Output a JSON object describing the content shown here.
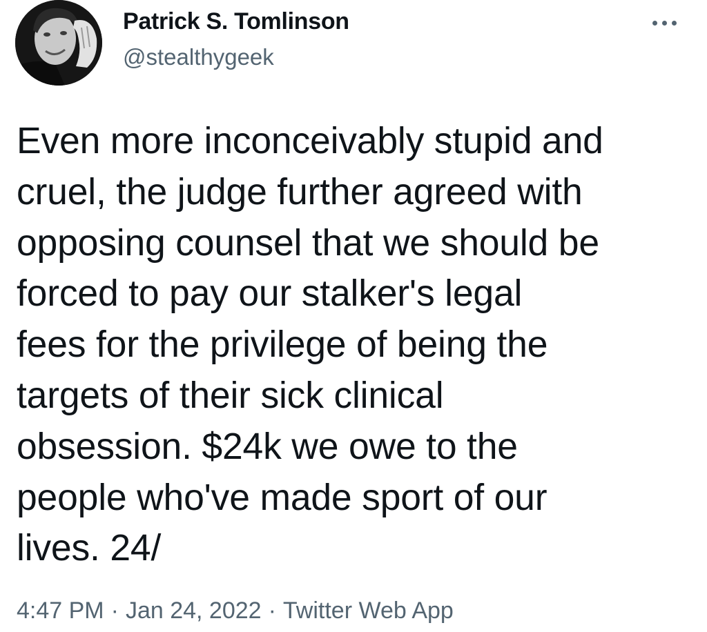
{
  "author": {
    "display_name": "Patrick S. Tomlinson",
    "handle": "@stealthygeek",
    "avatar_icon": "profile-photo"
  },
  "more_icon": "more-horizontal-icon",
  "tweet": {
    "text": "Even more inconceivably stupid and\ncruel, the judge further agreed with\nopposing counsel that we should be\nforced to pay our stalker's legal\nfees for the privilege of being the\ntargets of their sick clinical\nobsession. $24k we owe to the\npeople who've made sport of our\nlives. 24/"
  },
  "meta": {
    "time": "4:47 PM",
    "separator": "·",
    "date": "Jan 24, 2022",
    "source": "Twitter Web App"
  },
  "colors": {
    "text": "#0f1419",
    "secondary": "#536471",
    "background": "#ffffff"
  }
}
